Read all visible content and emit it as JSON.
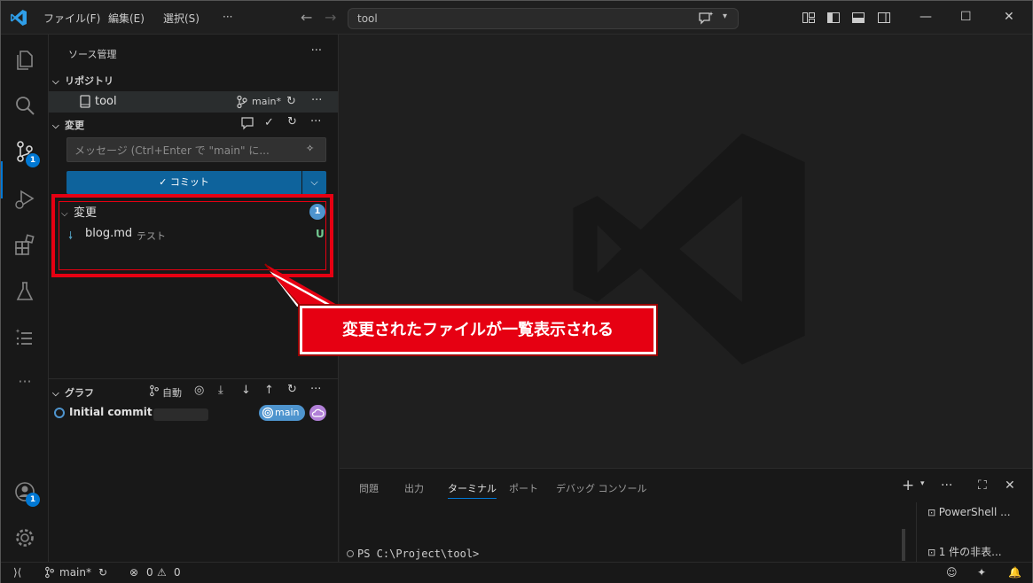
{
  "titlebar": {
    "menu_file": "ファイル(F)",
    "menu_edit": "編集(E)",
    "menu_select": "選択(S)",
    "menu_more": "···",
    "search_text": "tool"
  },
  "activity": {
    "scm_badge": "1",
    "accounts_badge": "1",
    "more": "···"
  },
  "sidebar": {
    "title": "ソース管理",
    "title_more": "···",
    "repositories_header": "リポジトリ",
    "repo_name": "tool",
    "repo_branch": "main*",
    "changes_header": "変更",
    "message_placeholder": "メッセージ (Ctrl+Enter で \"main\" に...",
    "commit_label": "コミット",
    "changes_group_label": "変更",
    "changes_count": "1",
    "file_name": "blog.md",
    "file_desc": "テスト",
    "file_status": "U",
    "graph_header": "グラフ",
    "graph_auto": "自動",
    "commit_message": "Initial commit",
    "branch_pill": "main"
  },
  "panel": {
    "tabs": [
      "問題",
      "出力",
      "ターミナル",
      "ポート",
      "デバッグ コンソール"
    ],
    "active_tab": "ターミナル",
    "terminal_prompt": "PS C:\\Project\\tool>",
    "side_items": [
      "PowerShell ...",
      "1 件の非表..."
    ]
  },
  "statusbar": {
    "branch": "main*",
    "errors": "0",
    "warnings": "0"
  },
  "callout": {
    "text": "変更されたファイルが一覧表示される"
  },
  "colors": {
    "accent": "#0078d4",
    "callout_red": "#e60012",
    "untracked_green": "#73c991",
    "badge_blue": "#4e94ce"
  }
}
